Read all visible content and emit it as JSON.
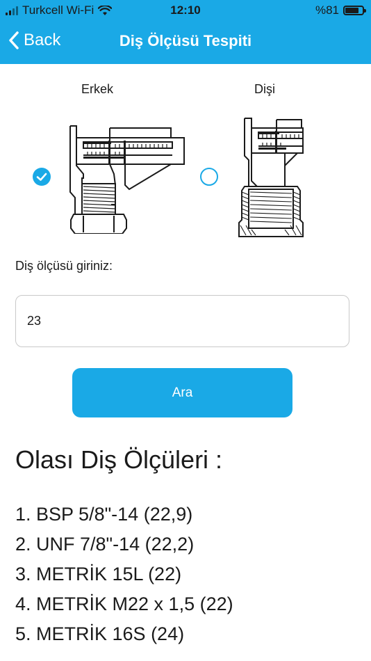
{
  "status_bar": {
    "carrier": "Turkcell Wi-Fi",
    "time": "12:10",
    "battery": "%81",
    "battery_level": 0.81
  },
  "nav": {
    "back_label": "Back",
    "title": "Diş Ölçüsü Tespiti"
  },
  "options": [
    {
      "label": "Erkek",
      "selected": true,
      "icon": "male-thread-caliper-icon"
    },
    {
      "label": "Dişi",
      "selected": false,
      "icon": "female-thread-caliper-icon"
    }
  ],
  "form": {
    "input_label": "Diş ölçüsü giriniz:",
    "input_value": "23",
    "search_label": "Ara"
  },
  "results": {
    "title": "Olası Diş Ölçüleri :",
    "items": [
      "1. BSP 5/8\"-14 (22,9)",
      "2. UNF 7/8\"-14 (22,2)",
      "3. METRİK 15L (22)",
      "4. METRİK M22 x 1,5 (22)",
      "5. METRİK 16S (24)"
    ]
  },
  "colors": {
    "accent": "#1aa9e6",
    "text": "#1a1a1a",
    "border": "#c9c9c9"
  }
}
